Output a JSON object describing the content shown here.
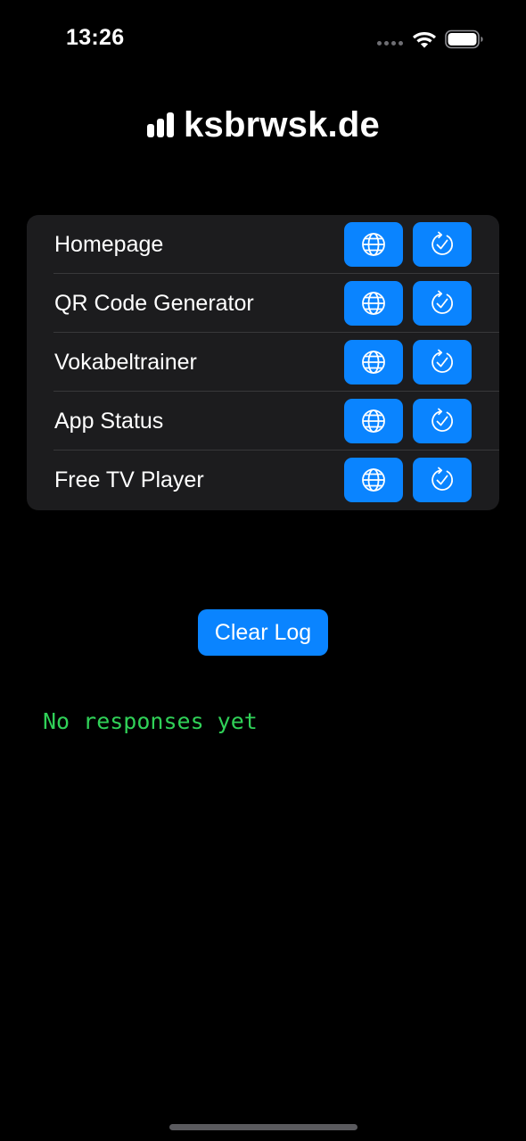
{
  "status_bar": {
    "time": "13:26",
    "icons": [
      "signal-dots-icon",
      "wifi-icon",
      "battery-icon"
    ]
  },
  "app": {
    "title": "ksbrwsk.de",
    "title_icon": "bar-chart-icon"
  },
  "services": [
    {
      "label": "Homepage",
      "web_icon": "globe-icon",
      "check_icon": "refresh-check-icon"
    },
    {
      "label": "QR Code Generator",
      "web_icon": "globe-icon",
      "check_icon": "refresh-check-icon"
    },
    {
      "label": "Vokabeltrainer",
      "web_icon": "globe-icon",
      "check_icon": "refresh-check-icon"
    },
    {
      "label": "App Status",
      "web_icon": "globe-icon",
      "check_icon": "refresh-check-icon"
    },
    {
      "label": "Free TV Player",
      "web_icon": "globe-icon",
      "check_icon": "refresh-check-icon"
    }
  ],
  "actions": {
    "clear_log_label": "Clear Log"
  },
  "log": {
    "text": "No responses yet"
  },
  "colors": {
    "background": "#000000",
    "card": "#1c1c1e",
    "accent": "#0a84ff",
    "log_text": "#30d158"
  }
}
